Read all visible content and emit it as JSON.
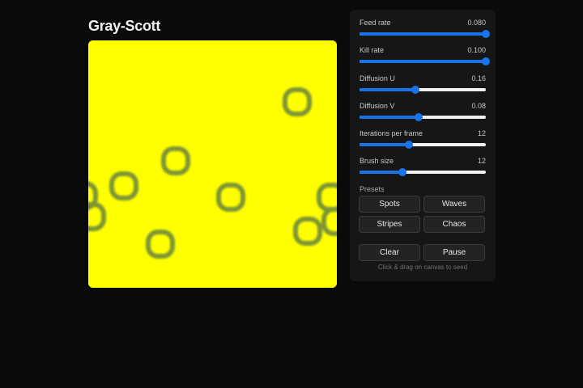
{
  "title": "Gray-Scott",
  "controls": [
    {
      "label": "Feed rate",
      "value_text": "0.080",
      "fraction": 1.0
    },
    {
      "label": "Kill rate",
      "value_text": "0.100",
      "fraction": 1.0
    },
    {
      "label": "Diffusion U",
      "value_text": "0.16",
      "fraction": 0.44
    },
    {
      "label": "Diffusion V",
      "value_text": "0.08",
      "fraction": 0.47
    },
    {
      "label": "Iterations per frame",
      "value_text": "12",
      "fraction": 0.39
    },
    {
      "label": "Brush size",
      "value_text": "12",
      "fraction": 0.34
    }
  ],
  "presets": {
    "label": "Presets",
    "spots": "Spots",
    "waves": "Waves",
    "stripes": "Stripes",
    "chaos": "Chaos"
  },
  "actions": {
    "clear": "Clear",
    "pause": "Pause"
  },
  "hint": "Click & drag on canvas to seed",
  "colors": {
    "background": "#0a0a0a",
    "panel": "#161616",
    "canvas": "#ffff00",
    "spot": "#6f8a3a",
    "accent": "#1a73e8"
  }
}
